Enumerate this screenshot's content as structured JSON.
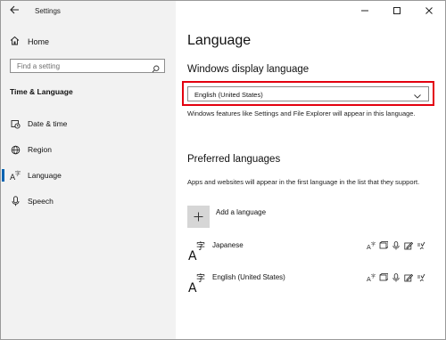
{
  "window": {
    "app_title": "Settings",
    "back_icon": "back-arrow-icon",
    "controls": [
      "minimize-icon",
      "maximize-icon",
      "close-icon"
    ]
  },
  "sidebar": {
    "home_label": "Home",
    "search_placeholder": "Find a setting",
    "section_title": "Time & Language",
    "items": [
      {
        "label": "Date & time",
        "icon": "calendar-clock-icon",
        "selected": false
      },
      {
        "label": "Region",
        "icon": "globe-icon",
        "selected": false
      },
      {
        "label": "Language",
        "icon": "language-icon",
        "selected": true
      },
      {
        "label": "Speech",
        "icon": "microphone-icon",
        "selected": false
      }
    ]
  },
  "main": {
    "title": "Language",
    "display_language": {
      "heading": "Windows display language",
      "selected_value": "English (United States)",
      "description": "Windows features like Settings and File Explorer will appear in this language."
    },
    "preferred": {
      "heading": "Preferred languages",
      "description": "Apps and websites will appear in the first language in the list that they support.",
      "add_label": "Add a language",
      "languages": [
        {
          "name": "Japanese"
        },
        {
          "name": "English (United States)"
        }
      ],
      "feature_icons": [
        "display-language-icon",
        "language-pack-icon",
        "speech-icon",
        "handwriting-icon",
        "spellcheck-icon"
      ]
    }
  },
  "colors": {
    "accent": "#0063b1",
    "highlight_border": "#e3000f",
    "sidebar_bg": "#f2f2f2"
  }
}
